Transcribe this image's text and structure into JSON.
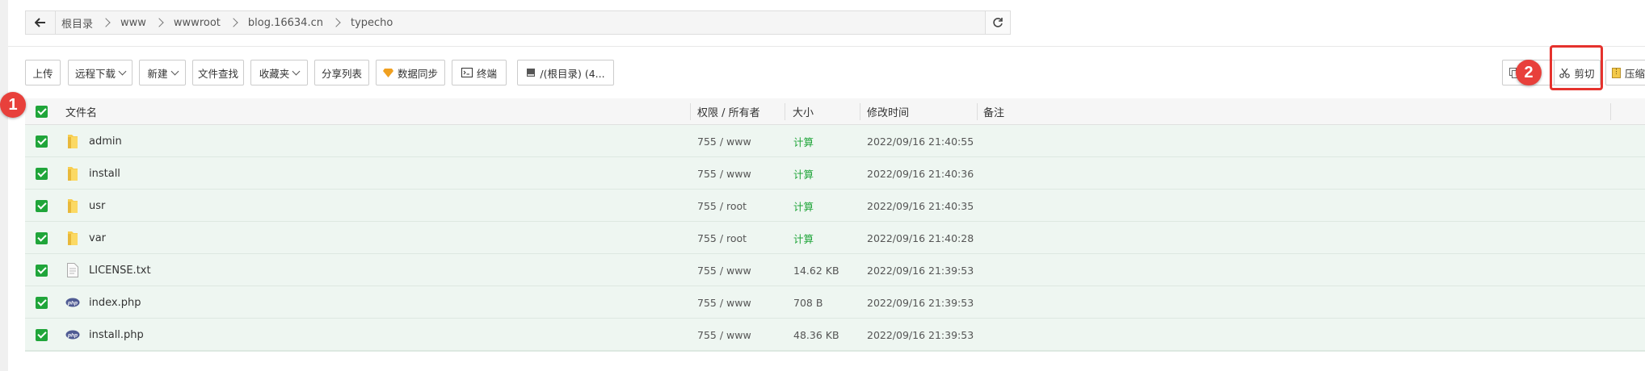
{
  "path": {
    "crumbs": [
      "根目录",
      "www",
      "wwwroot",
      "blog.16634.cn",
      "typecho"
    ]
  },
  "toolbar": {
    "upload": "上传",
    "remote_download": "远程下载",
    "new": "新建",
    "find_file": "文件查找",
    "favorites": "收藏夹",
    "share_list": "分享列表",
    "data_sync": "数据同步",
    "terminal": "终端",
    "disk": "/(根目录) (4...",
    "cut": "剪切",
    "compress": "压缩"
  },
  "table": {
    "headers": {
      "name": "文件名",
      "perm": "权限 / 所有者",
      "size": "大小",
      "mtime": "修改时间",
      "note": "备注"
    },
    "rows": [
      {
        "name": "admin",
        "type": "folder",
        "perm": "755 / www",
        "size": "计算",
        "mtime": "2022/09/16 21:40:55"
      },
      {
        "name": "install",
        "type": "folder",
        "perm": "755 / www",
        "size": "计算",
        "mtime": "2022/09/16 21:40:36"
      },
      {
        "name": "usr",
        "type": "folder",
        "perm": "755 / root",
        "size": "计算",
        "mtime": "2022/09/16 21:40:35"
      },
      {
        "name": "var",
        "type": "folder",
        "perm": "755 / root",
        "size": "计算",
        "mtime": "2022/09/16 21:40:28"
      },
      {
        "name": "LICENSE.txt",
        "type": "text",
        "perm": "755 / www",
        "size": "14.62 KB",
        "mtime": "2022/09/16 21:39:53"
      },
      {
        "name": "index.php",
        "type": "php",
        "perm": "755 / www",
        "size": "708 B",
        "mtime": "2022/09/16 21:39:53"
      },
      {
        "name": "install.php",
        "type": "php",
        "perm": "755 / www",
        "size": "48.36 KB",
        "mtime": "2022/09/16 21:39:53"
      }
    ]
  },
  "annotations": {
    "step1": "1",
    "step2": "2"
  },
  "colors": {
    "accent_green": "#20a53a",
    "selected_row": "#eef6f1",
    "annotation_red": "#e8403b"
  }
}
